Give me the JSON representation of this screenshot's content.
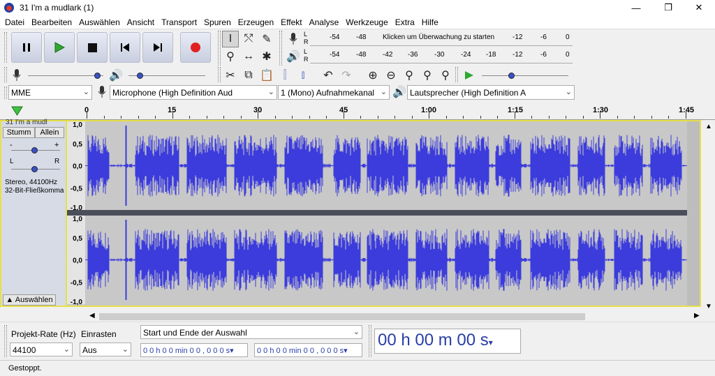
{
  "window": {
    "title": "31 I'm a mudlark (1)",
    "minimize": "—",
    "maximize": "❐",
    "close": "✕"
  },
  "menu": [
    "Datei",
    "Bearbeiten",
    "Auswählen",
    "Ansicht",
    "Transport",
    "Spuren",
    "Erzeugen",
    "Effekt",
    "Analyse",
    "Werkzeuge",
    "Extra",
    "Hilfe"
  ],
  "meters": {
    "record_ticks": [
      "-54",
      "-48",
      "Klicken um Überwachung zu starten",
      "-12",
      "-6",
      "0"
    ],
    "play_ticks": [
      "-54",
      "-48",
      "-42",
      "-36",
      "-30",
      "-24",
      "-18",
      "-12",
      "-6",
      "0"
    ],
    "l": "L",
    "r": "R"
  },
  "device": {
    "host": "MME",
    "input": "Microphone (High Definition Aud",
    "channels": "1 (Mono) Aufnahmekanal",
    "output": "Lautsprecher (High Definition A"
  },
  "ruler": {
    "labels": [
      "0",
      "15",
      "30",
      "45",
      "1:00",
      "1:15",
      "1:30",
      "1:45"
    ]
  },
  "track": {
    "name": "31 I'm a mudl",
    "mute": "Stumm",
    "solo": "Allein",
    "minus": "-",
    "plus": "+",
    "pan_l": "L",
    "pan_r": "R",
    "info1": "Stereo, 44100Hz",
    "info2": "32-Bit-Fließkomma",
    "select": "Auswählen",
    "y_labels": [
      "1,0",
      "0,5",
      "0,0",
      "-0,5",
      "-1,0"
    ]
  },
  "selection": {
    "rate_label": "Projekt-Rate (Hz)",
    "snap_label": "Einrasten",
    "rate_value": "44100",
    "snap_value": "Aus",
    "mode": "Start und Ende der Auswahl",
    "start_time": "0 0 h 0 0 min 0 0 , 0 0 0 s",
    "end_time": "0 0 h 0 0 min 0 0 , 0 0 0 s",
    "big_time": "00 h 00 m 00 s"
  },
  "status": {
    "text": "Gestoppt."
  },
  "colors": {
    "wave": "#3c3cdc",
    "track_bg": "#c8c8c8",
    "selection_border": "#e7e04a",
    "record": "#e02020",
    "play": "#2fa82f"
  }
}
